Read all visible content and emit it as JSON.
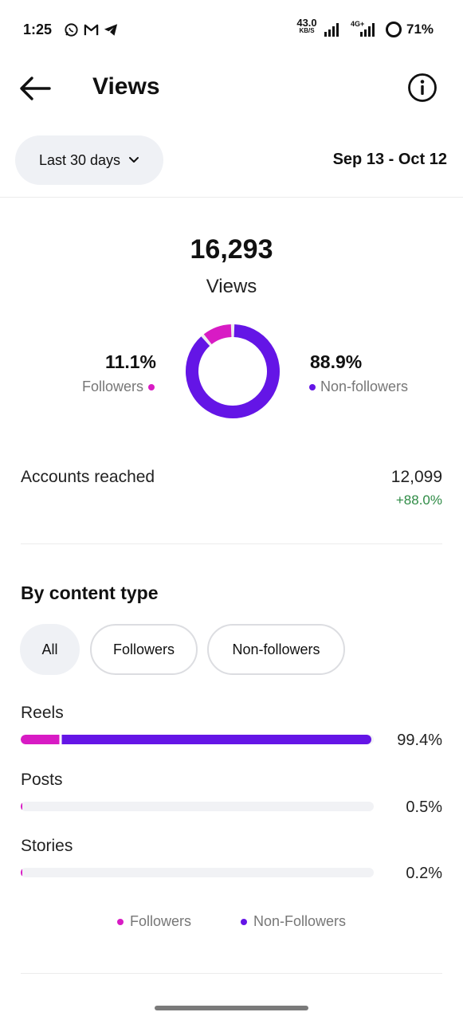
{
  "status_bar": {
    "time": "1:25",
    "left_icons": [
      "whatsapp-icon",
      "gmail-icon",
      "telegram-icon"
    ],
    "net_speed_value": "43.0",
    "net_speed_unit": "KB/S",
    "network_label": "4G+",
    "battery": "71%"
  },
  "header": {
    "title": "Views",
    "back_icon": "arrow-left-icon",
    "info_icon": "info-circle-icon"
  },
  "date_row": {
    "period": "Last 30 days",
    "range": "Sep 13 - Oct 12"
  },
  "summary": {
    "total": "16,293",
    "label": "Views",
    "followers_pct": "11.1%",
    "followers_label": "Followers",
    "nonfollowers_pct": "88.9%",
    "nonfollowers_label": "Non-followers",
    "donut": {
      "followers_fraction": 0.111,
      "nonfollowers_fraction": 0.889
    }
  },
  "accounts_reached": {
    "label": "Accounts reached",
    "value": "12,099",
    "change": "+88.0%"
  },
  "content_type": {
    "title": "By content type",
    "filters": [
      "All",
      "Followers",
      "Non-followers"
    ],
    "selected_filter": "All",
    "rows": [
      {
        "label": "Reels",
        "pct": "99.4%",
        "value": 0.994,
        "followers_share": 0.11
      },
      {
        "label": "Posts",
        "pct": "0.5%",
        "value": 0.005,
        "followers_share": 1.0
      },
      {
        "label": "Stories",
        "pct": "0.2%",
        "value": 0.002,
        "followers_share": 1.0
      }
    ],
    "legend": [
      "Followers",
      "Non-Followers"
    ]
  },
  "colors": {
    "followers": "#d81bc4",
    "nonfollowers": "#6415e6",
    "positive": "#2e8b45"
  }
}
